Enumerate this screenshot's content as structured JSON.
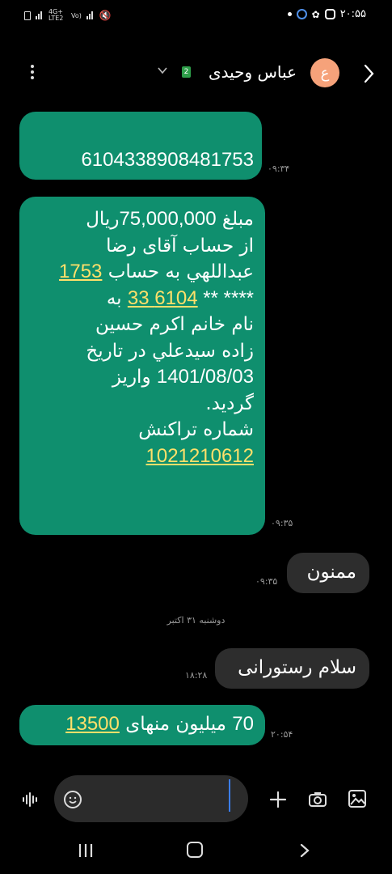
{
  "status_bar": {
    "time": "۲۰:۵۵",
    "network": "4G+ LTE2",
    "volte": "Vo)"
  },
  "header": {
    "contact_name": "عباس وحیدی",
    "avatar_letter": "ع",
    "sim_slot": "2"
  },
  "messages": [
    {
      "direction": "incoming",
      "lines": [
        [
          {
            "t": "6104338908481753",
            "cls": "num"
          }
        ]
      ],
      "time": "۰۹:۳۴"
    },
    {
      "direction": "incoming",
      "lines": [
        [
          {
            "t": "مبلغ "
          },
          {
            "t": "75,000,000",
            "cls": "num"
          },
          {
            "t": "ريال"
          }
        ],
        [
          {
            "t": "از حساب آقای رضا"
          }
        ],
        [
          {
            "t": "عبداللهي به حساب "
          },
          {
            "t": "1753",
            "cls": "num link"
          }
        ],
        [
          {
            "t": "**** ** ",
            "cls": "num"
          },
          {
            "t": "6104 33",
            "cls": "num link"
          },
          {
            "t": " به"
          }
        ],
        [
          {
            "t": "نام خانم اكرم حسين"
          }
        ],
        [
          {
            "t": "زاده سيدعلي در تاريخ"
          }
        ],
        [
          {
            "t": "1401/08/03",
            "cls": "num"
          },
          {
            "t": " واريز"
          }
        ],
        [
          {
            "t": "گرديد."
          }
        ],
        [
          {
            "t": "شماره تراكنش"
          }
        ],
        [
          {
            "t": "1021210612",
            "cls": "num link"
          }
        ]
      ],
      "time": "۰۹:۳۵"
    },
    {
      "direction": "outgoing",
      "text": "ممنون",
      "time": "۰۹:۳۵"
    },
    {
      "direction": "outgoing",
      "text": "سلام رستورانی",
      "time": "۱۸:۲۸"
    },
    {
      "direction": "incoming",
      "lines": [
        [
          {
            "t": "70",
            "cls": "num"
          },
          {
            "t": " میلیون منهای "
          },
          {
            "t": "13500",
            "cls": "num link"
          }
        ]
      ],
      "time": "۲۰:۵۴"
    }
  ],
  "date_separator": "دوشنبه ۳۱ اکتبر",
  "composer": {
    "placeholder": ""
  },
  "colors": {
    "incoming_bubble": "#0f8f6e",
    "outgoing_bubble": "#2d2d2d",
    "link": "#ffe06a",
    "avatar": "#f6a27a",
    "caret": "#3b7ef2"
  }
}
